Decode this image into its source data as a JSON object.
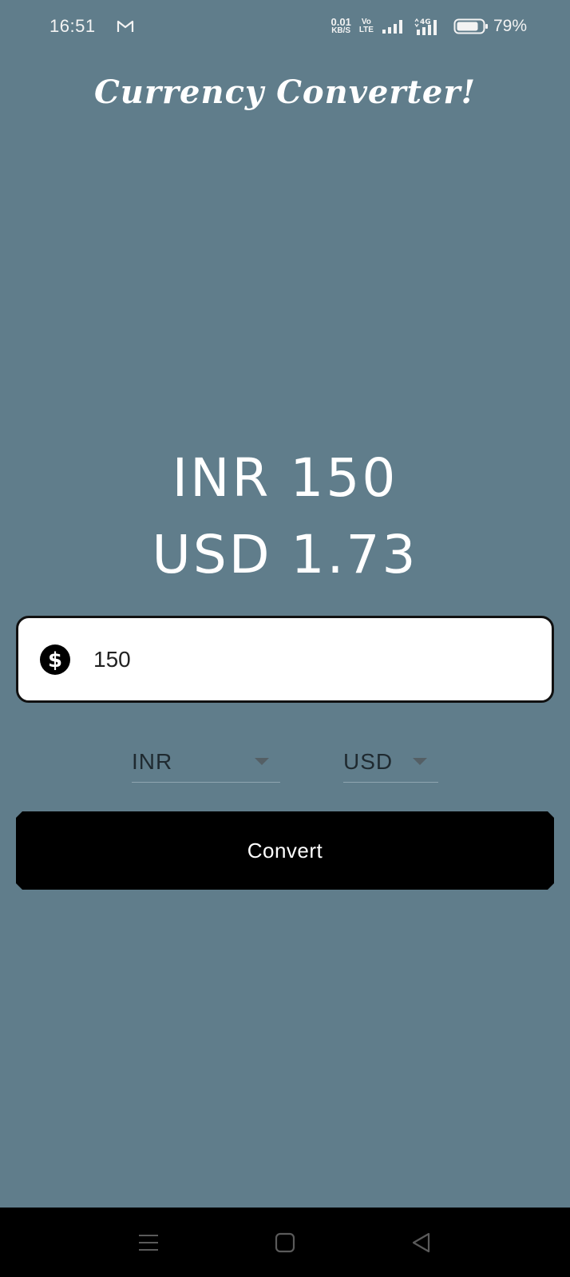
{
  "status_bar": {
    "time": "16:51",
    "net_speed_value": "0.01",
    "net_speed_unit": "KB/S",
    "volte_top": "Vo",
    "volte_bottom": "LTE",
    "network_type": "4G",
    "battery_percent": "79%",
    "icons": [
      "gmail-icon",
      "signal-icon",
      "signal-4g-icon",
      "battery-icon"
    ]
  },
  "app": {
    "title": "Currency Converter!"
  },
  "result": {
    "from_text": "INR 150",
    "to_text": "USD 1.73"
  },
  "amount_input": {
    "value": "150",
    "icon": "dollar-icon"
  },
  "dropdowns": {
    "from_currency": "INR",
    "to_currency": "USD"
  },
  "convert_button": {
    "label": "Convert"
  },
  "nav_bar": {
    "icons": [
      "menu-icon",
      "home-icon",
      "back-icon"
    ]
  },
  "colors": {
    "background": "#607d8b",
    "button": "#000000",
    "input_bg": "#ffffff"
  }
}
